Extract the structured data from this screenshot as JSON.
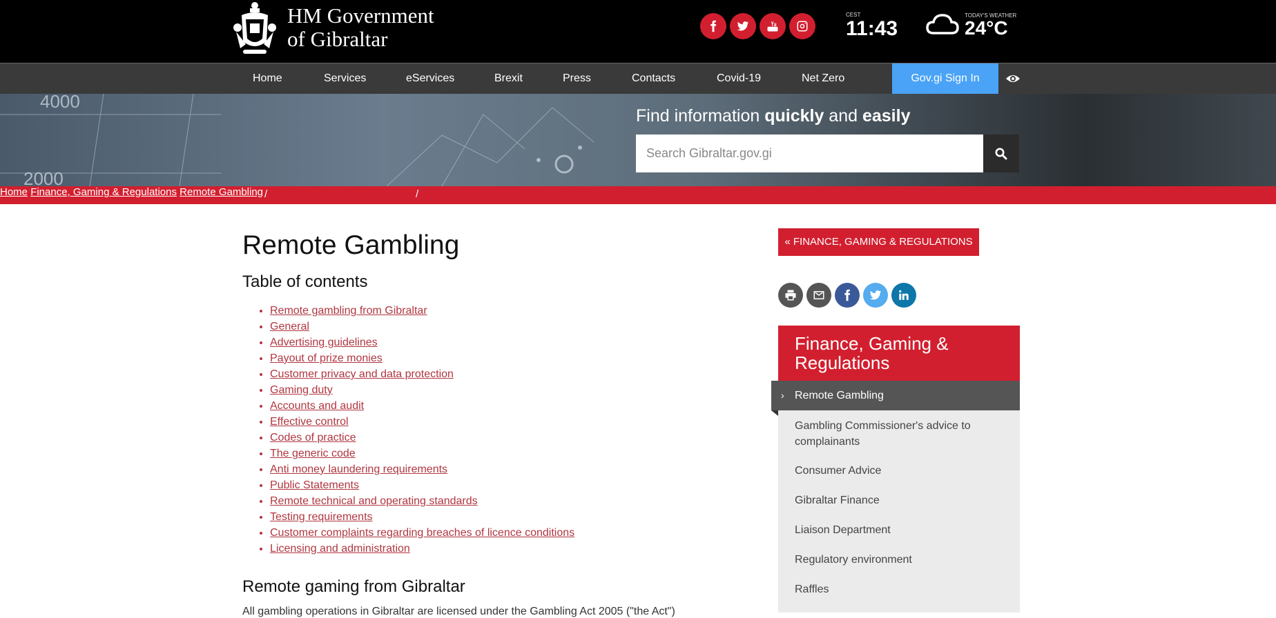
{
  "header": {
    "brand_line1": "HM Government",
    "brand_line2": "of Gibraltar",
    "timezone": "CEST",
    "time": "11:43",
    "weather_label": "TODAY'S WEATHER",
    "temperature": "24°C",
    "social_icons": [
      "facebook-icon",
      "twitter-icon",
      "youtube-icon",
      "instagram-icon"
    ],
    "accent": "#d21f2f"
  },
  "nav": {
    "items": [
      "Home",
      "Services",
      "eServices",
      "Brexit",
      "Press",
      "Contacts",
      "Covid-19",
      "Net Zero"
    ],
    "signin": "Gov.gi Sign In",
    "signin_color": "#4aa3f6"
  },
  "hero": {
    "text_a": "Find information ",
    "text_b": "quickly",
    "text_c": " and ",
    "text_d": "easily",
    "search_placeholder": "Search Gibraltar.gov.gi"
  },
  "breadcrumb": {
    "home": "Home",
    "sep1": "/",
    "section": "Finance, Gaming & Regulations",
    "sep2": "/",
    "current": "Remote Gambling"
  },
  "main": {
    "title": "Remote Gambling",
    "toc_heading": "Table of contents",
    "toc": [
      "Remote gambling from Gibraltar",
      "General",
      "Advertising guidelines",
      "Payout of prize monies",
      "Customer privacy and data protection",
      "Gaming duty",
      "Accounts and audit",
      "Effective control",
      "Codes of practice",
      "The generic code",
      "Anti money laundering requirements",
      "Public Statements",
      "Remote technical and operating standards",
      "Testing requirements",
      "Customer complaints regarding breaches of licence conditions",
      "Licensing and administration"
    ],
    "section_heading": "Remote gaming from Gibraltar",
    "section_text": "All gambling operations in Gibraltar are licensed under the Gambling Act 2005 (\"the Act\")"
  },
  "sidebar": {
    "back_button": "FINANCE, GAMING & REGULATIONS",
    "share_icons": [
      "print-icon",
      "email-icon",
      "facebook-icon",
      "twitter-icon",
      "linkedin-icon"
    ],
    "heading": "Finance, Gaming & Regulations",
    "active_item": "Remote Gambling",
    "items": [
      "Gambling Commissioner's advice to complainants",
      "Consumer Advice",
      "Gibraltar Finance",
      "Liaison Department",
      "Regulatory environment",
      "Raffles"
    ]
  }
}
